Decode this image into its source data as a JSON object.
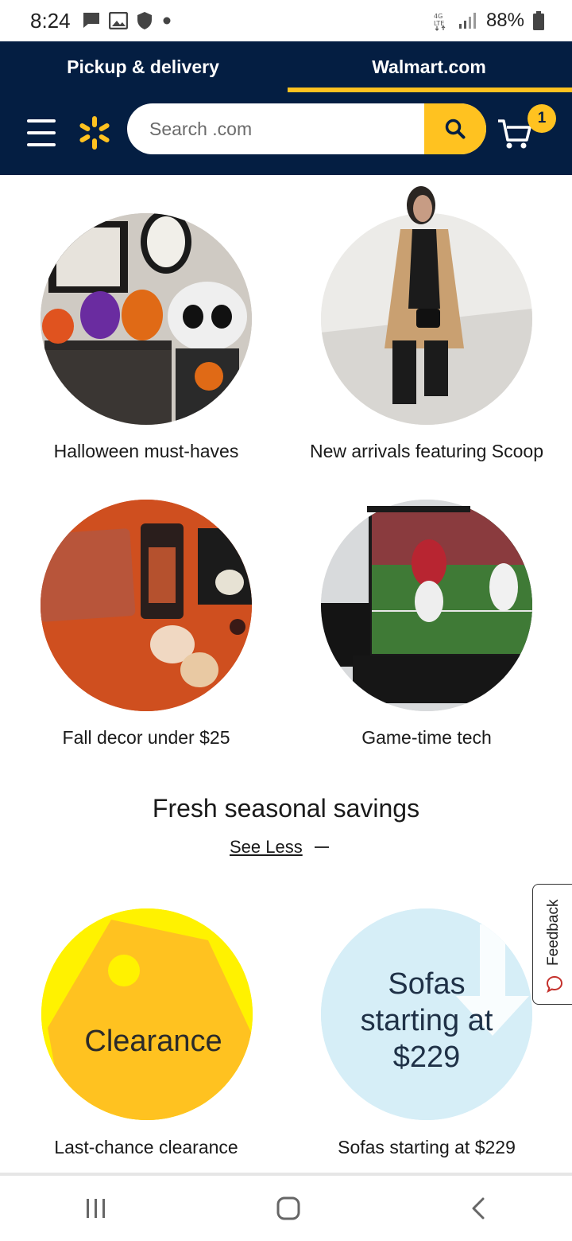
{
  "status_bar": {
    "time": "8:24",
    "battery": "88%",
    "icons": [
      "message-icon",
      "image-icon",
      "shield-icon",
      "dot-icon",
      "lte-icon",
      "signal-icon",
      "battery-icon"
    ]
  },
  "header": {
    "tabs": [
      {
        "label": "Pickup & delivery",
        "active": false
      },
      {
        "label": "Walmart.com",
        "active": true
      }
    ],
    "search": {
      "placeholder": "Search .com"
    },
    "cart_count": "1",
    "colors": {
      "navy": "#041e42",
      "accent": "#ffc220"
    }
  },
  "tiles": [
    {
      "label": "Halloween must-haves",
      "image": "halloween-decor-image"
    },
    {
      "label": "New arrivals featuring Scoop",
      "image": "coat-model-image"
    },
    {
      "label": "Fall decor under $25",
      "image": "fall-decor-image"
    },
    {
      "label": "Game-time tech",
      "image": "football-tv-image"
    }
  ],
  "section": {
    "title": "Fresh seasonal savings",
    "toggle_label": "See Less"
  },
  "savings_tiles": [
    {
      "label": "Last-chance clearance",
      "badge_text": "Clearance"
    },
    {
      "label": "Sofas starting at $229",
      "badge_lines": [
        "Sofas",
        "starting at",
        "$229"
      ]
    }
  ],
  "feedback": {
    "label": "Feedback"
  },
  "nav": [
    "recent-apps-icon",
    "home-icon",
    "back-icon"
  ]
}
